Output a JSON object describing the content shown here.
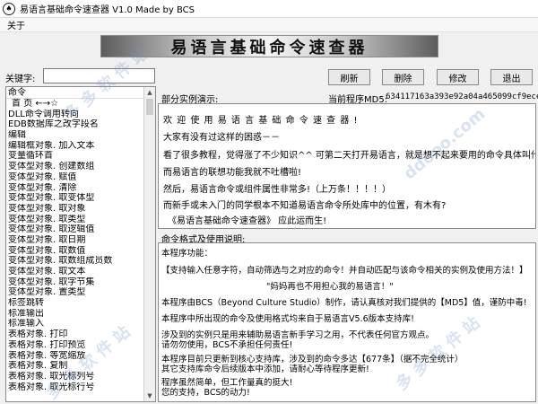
{
  "window": {
    "title": "易语言基础命令速查器 V1.0 Made by BCS",
    "icon": "app-logo-icon"
  },
  "menu": {
    "items": [
      "关于"
    ]
  },
  "banner": {
    "text": "易语言基础命令速查器"
  },
  "search": {
    "label": "关键字:",
    "value": ""
  },
  "buttons": {
    "refresh": "刷新",
    "delete": "删除",
    "modify": "修改",
    "exit": "退出"
  },
  "cmd_list": {
    "header": "命令",
    "items": [
      "首  页  ←→☆",
      "DLL命令调用转向",
      "EDB数据库之改字段名",
      "编辑",
      "编辑框对象. 加入文本",
      "变量循环首",
      "变体型对象. 创建数组",
      "变体型对象. 赋值",
      "变体型对象. 清除",
      "变体型对象. 取变体型",
      "变体型对象. 取对象",
      "变体型对象. 取类型",
      "变体型对象. 取逻辑值",
      "变体型对象. 取日期",
      "变体型对象. 取数值",
      "变体型对象. 取数组成员数",
      "变体型对象. 取文本",
      "变体型对象. 取字节集",
      "变体型对象. 置类型",
      "标签跳转",
      "标准输出",
      "标准输入",
      "表格对象. 打印",
      "表格对象. 打印预览",
      "表格对象. 等宽缩放",
      "表格对象. 复制",
      "表格对象. 取光标列号",
      "表格对象. 取光标行号"
    ]
  },
  "examples": {
    "label": "部分实例演示:",
    "current_label": "当前程序MD5:",
    "current_value": "634117163a393e92a04a465099cf9ece",
    "lines": [
      "欢 迎 使 用 易 语 言 基 础 命 令 速 查 器 !",
      "大家有没有过这样的困惑－－",
      "看了很多教程，觉得涨了不少知识^^  可第二天打开易语言，就是想不起来要用的命令具体叫什么?",
      "而易语言的联想功能我就不吐槽啦!",
      "然后，易语言命令或组件属性非常多!（上万条！！！！）",
      "而新手或未入门的同学根本不知道易语言命令所处库中的位置，有木有?",
      "《易语言基础命令速查器》     应此运而生!"
    ]
  },
  "usage": {
    "label": "命令格式及使用说明:",
    "lines": [
      "本程序功能：",
      "【支持输入任意字符，自动筛选与之对应的命令！并自动匹配与该命令相关的实例及使用方法！】",
      "\"妈妈再也不用担心我的易语言！\"",
      "本程序由BCS（Beyond Culture Studio）制作，请认真核对我们提供的【MD5】值，谨防中毒!",
      "本程序中所出现的命令及使用格式均来自于易语言V5.6版本支持库!",
      "涉及到的实例只是用来辅助易语言新手学习之用，不代表任何官方观点。",
      "请勿勿使用，BCS不承担任何责任!",
      "本程序目前只更新到核心支持库，涉及到的命令多达【677条】（据不完全统计）",
      "其它支持库命令后续版本中添加，请耐心等待程序更新!",
      "程序虽然简单，但工作量真的挺大!",
      "您的支持，BCS的动力!"
    ]
  }
}
